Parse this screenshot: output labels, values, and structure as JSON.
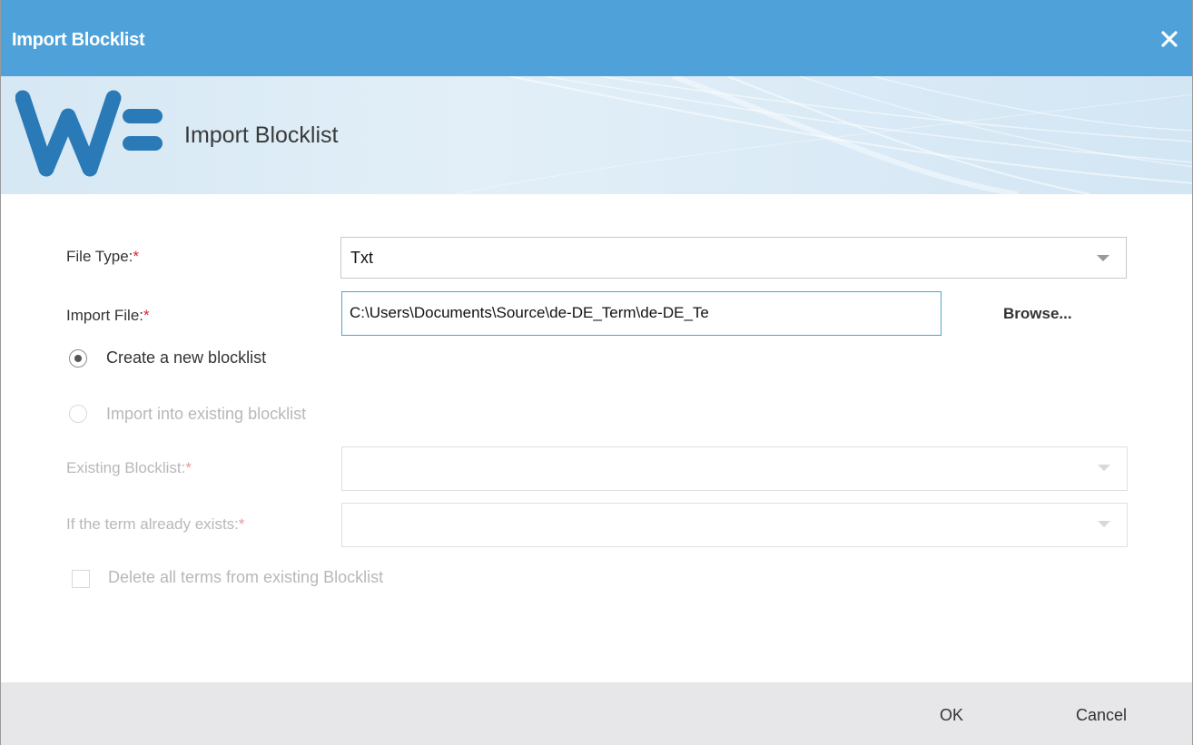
{
  "dialog": {
    "title": "Import Blocklist",
    "close_icon": "close-icon",
    "banner_heading": "Import Blocklist",
    "logo_icon": "wf-logo-icon"
  },
  "form": {
    "file_type": {
      "label": "File Type:",
      "required_mark": "*",
      "value": "Txt"
    },
    "import_file": {
      "label": "Import File:",
      "required_mark": "*",
      "value": "C:\\Users\\Documents\\Source\\de-DE_Term\\de-DE_Te",
      "browse_label": "Browse..."
    },
    "create_new": {
      "label": "Create a new blocklist",
      "selected": true
    },
    "import_existing": {
      "label": "Import into existing blocklist",
      "selected": false
    },
    "existing_blocklist": {
      "label": "Existing Blocklist:",
      "required_mark": "*",
      "value": ""
    },
    "term_exists": {
      "label": "If the term already exists:",
      "required_mark": "*",
      "value": ""
    },
    "delete_all": {
      "label": "Delete all terms from existing Blocklist",
      "checked": false
    }
  },
  "footer": {
    "ok_label": "OK",
    "cancel_label": "Cancel"
  },
  "colors": {
    "titlebar": "#4ea2d9",
    "logo": "#2a7ab8",
    "required": "#d9232e",
    "footer": "#e7e7e9"
  }
}
